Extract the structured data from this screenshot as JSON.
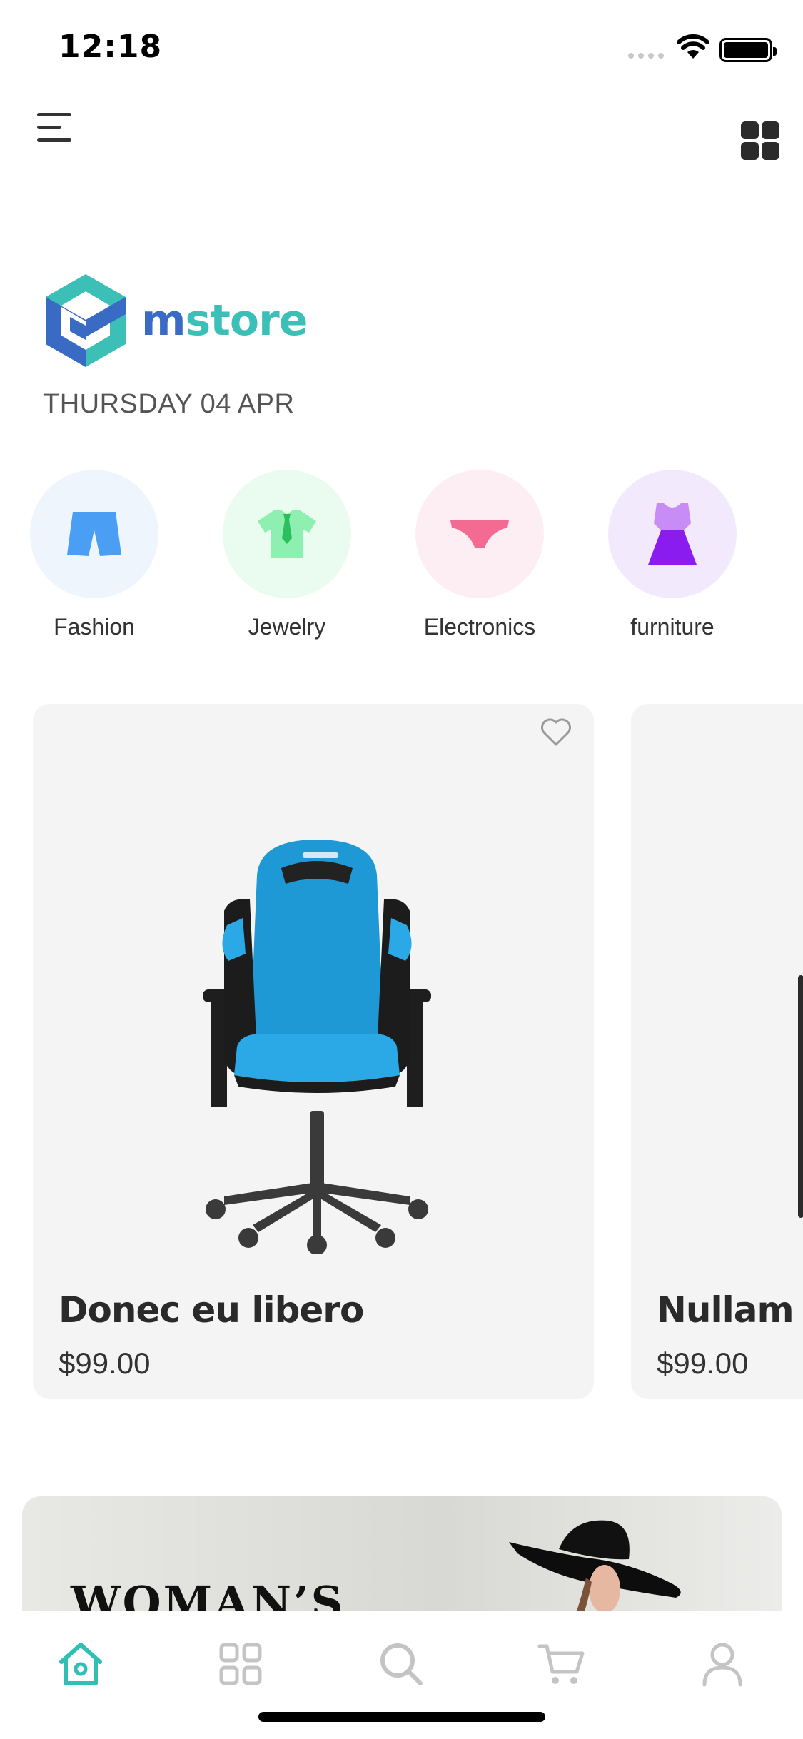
{
  "status_bar": {
    "time": "12:18"
  },
  "brand": {
    "logo_letter": "m",
    "logo_rest": "store"
  },
  "date": "THURSDAY 04 APR",
  "categories": [
    {
      "label": "Fashion",
      "icon": "shorts-icon",
      "bg": "#eef5fd",
      "color": "#4a9ff5"
    },
    {
      "label": "Jewelry",
      "icon": "tshirt-icon",
      "bg": "#eafbef",
      "color": "#7ee8a2"
    },
    {
      "label": "Electronics",
      "icon": "underwear-icon",
      "bg": "#fdeef3",
      "color": "#f36a93"
    },
    {
      "label": "furniture",
      "icon": "dress-icon",
      "bg": "#f3e9fc",
      "color": "#8b2df0"
    }
  ],
  "products": [
    {
      "name": "Donec eu libero",
      "price": "$99.00"
    },
    {
      "name": "Nullam n",
      "price": "$99.00"
    }
  ],
  "banner": {
    "title": "WOMAN’S"
  },
  "tabbar": {
    "active_color": "#2fbfb4",
    "inactive_color": "#c4c4c4",
    "items": [
      "home-icon",
      "categories-icon",
      "search-icon",
      "cart-icon",
      "profile-icon"
    ]
  }
}
